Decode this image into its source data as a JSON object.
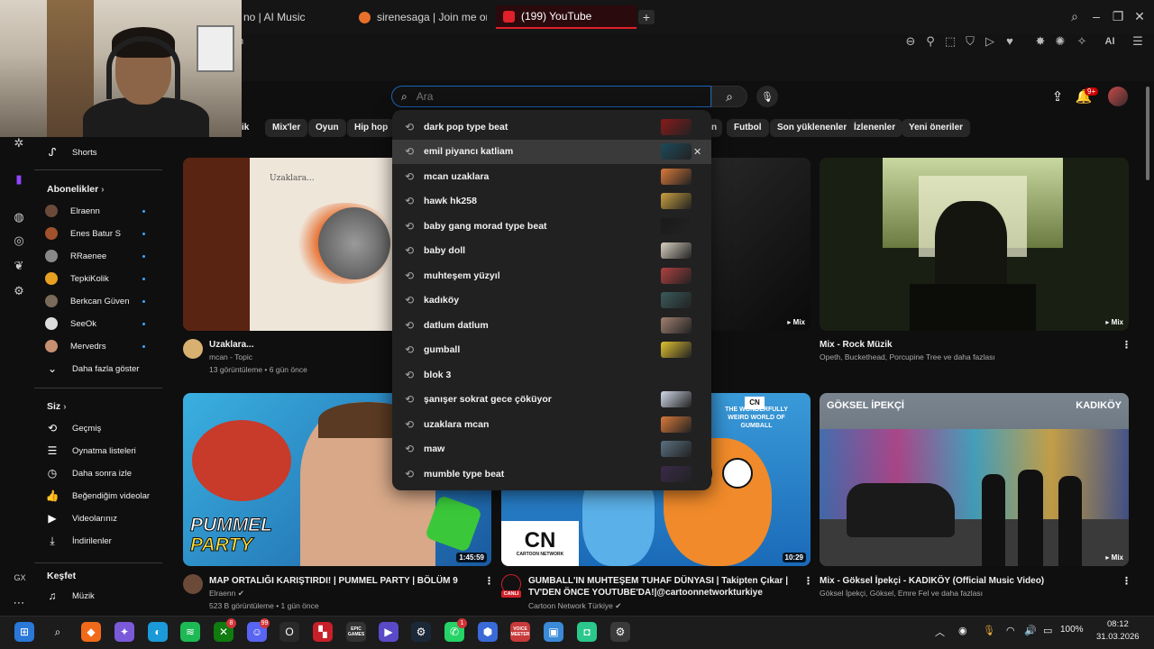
{
  "browser": {
    "tabs": [
      {
        "label": "no | AI Music",
        "active": false
      },
      {
        "label": "sirenesaga | Join me on St",
        "active": false
      },
      {
        "label": "(199) YouTube",
        "active": true
      }
    ],
    "new_tab": "+",
    "address_fragment": "n",
    "ai_label": "AI"
  },
  "header": {
    "search_placeholder": "Ara",
    "notification_count": "9+"
  },
  "chips": [
    "zik",
    "Mix'ler",
    "Oyun",
    "Hip hop",
    "n",
    "Futbol",
    "Son yüklenenler",
    "İzlenenler",
    "Yeni öneriler"
  ],
  "sidebar": {
    "shorts": "Shorts",
    "subscriptions_title": "Abonelikler",
    "subscriptions": [
      {
        "label": "Elraenn",
        "color": "#6b4a3a"
      },
      {
        "label": "Enes Batur S",
        "color": "#a0522d"
      },
      {
        "label": "RRaenee",
        "color": "#888888"
      },
      {
        "label": "TepkiKolik",
        "color": "#e8a020"
      },
      {
        "label": "Berkcan Güven",
        "color": "#7a6a5a"
      },
      {
        "label": "SeeOk",
        "color": "#dddddd"
      },
      {
        "label": "Mervedrs",
        "color": "#c89070"
      }
    ],
    "show_more": "Daha fazla göster",
    "you_title": "Siz",
    "you_items": [
      {
        "label": "Geçmiş",
        "icon": "history-icon"
      },
      {
        "label": "Oynatma listeleri",
        "icon": "playlist-icon"
      },
      {
        "label": "Daha sonra izle",
        "icon": "clock-icon"
      },
      {
        "label": "Beğendiğim videolar",
        "icon": "thumbs-up-icon"
      },
      {
        "label": "Videolarınız",
        "icon": "video-icon"
      },
      {
        "label": "İndirilenler",
        "icon": "download-icon"
      }
    ],
    "explore_title": "Keşfet",
    "music": "Müzik"
  },
  "suggestions": [
    {
      "text": "dark pop type beat",
      "color": "#8a1a1a"
    },
    {
      "text": "emil piyancı katliam",
      "color": "#1d4a5a"
    },
    {
      "text": "mcan uzaklara",
      "color": "#d97a3a"
    },
    {
      "text": "hawk hk258",
      "color": "#c8a040"
    },
    {
      "text": "baby gang morad type beat",
      "color": "#1a1a1a"
    },
    {
      "text": "baby doll",
      "color": "#d8d0c0"
    },
    {
      "text": "muhteşem yüzyıl",
      "color": "#b04040"
    },
    {
      "text": "kadıköy",
      "color": "#3a5a5a"
    },
    {
      "text": "datlum datlum",
      "color": "#a08070"
    },
    {
      "text": "gumball",
      "color": "#e0c030"
    },
    {
      "text": "blok 3",
      "color": ""
    },
    {
      "text": "şanışer sokrat gece çöküyor",
      "color": "#d0d8e8"
    },
    {
      "text": "uzaklara mcan",
      "color": "#d97a3a"
    },
    {
      "text": "maw",
      "color": "#5a7080"
    },
    {
      "text": "mumble type beat",
      "color": "#3a2a4a"
    }
  ],
  "videos": {
    "v1": {
      "title": "Uzaklara...",
      "channel": "mcan - Topic",
      "meta": "13 görüntüleme • 6 gün önce",
      "thumb_text": "Uzaklara..."
    },
    "v2": {
      "mix": "Mix"
    },
    "v3": {
      "title": "Mix - Rock Müzik",
      "meta": "Opeth, Buckethead, Porcupine Tree ve daha fazlası",
      "mix": "Mix"
    },
    "v4": {
      "title": "MAP ORTALIĞI KARIŞTIRDI! | PUMMEL PARTY | BÖLÜM 9",
      "channel": "Elraenn",
      "meta": "523 B görüntüleme • 1 gün önce",
      "duration": "1:45:59",
      "thumb_text_1": "PUMMEL",
      "thumb_text_2": "PARTY"
    },
    "v5": {
      "title": "GUMBALL'IN MUHTEŞEM TUHAF DÜNYASI | Takipten Çıkar | TV'DEN ÖNCE YOUTUBE'DA!|@cartoonnetworkturkiye",
      "channel": "Cartoon Network Türkiye",
      "duration": "10:29",
      "logo": "CN",
      "network": "CARTOON NETWORK",
      "live": "CANLI",
      "promo": "THE WONDERFULLY WEIRD WORLD OF GUMBALL"
    },
    "v6": {
      "title": "Mix - Göksel İpekçi - KADIKÖY (Official Music Video)",
      "meta": "Göksel İpekçi, Göksel, Emre Fel ve daha fazlası",
      "mix": "Mix",
      "thumb_left": "GÖKSEL İPEKÇİ",
      "thumb_right": "KADIKÖY"
    }
  },
  "taskbar": {
    "apps": [
      {
        "name": "windows-start-icon",
        "color": "#2a78d8",
        "badge": ""
      },
      {
        "name": "search-icon",
        "color": "",
        "badge": ""
      },
      {
        "name": "brave-icon",
        "color": "#f06a1a",
        "badge": ""
      },
      {
        "name": "copilot-icon",
        "color": "#7a5ad8",
        "badge": ""
      },
      {
        "name": "edge-icon",
        "color": "#1a9ad8",
        "badge": ""
      },
      {
        "name": "spotify-icon",
        "color": "#1db954",
        "badge": ""
      },
      {
        "name": "xbox-icon",
        "color": "#107c10",
        "badge": "8"
      },
      {
        "name": "discord-icon",
        "color": "#5865f2",
        "badge": "99"
      },
      {
        "name": "opera-gx-icon",
        "color": "#2a2a2a",
        "badge": ""
      },
      {
        "name": "office-icon",
        "color": "#c8202a",
        "badge": ""
      },
      {
        "name": "epic-games-icon",
        "color": "#333333",
        "badge": ""
      },
      {
        "name": "media-player-icon",
        "color": "#5a4ac8",
        "badge": ""
      },
      {
        "name": "steam-icon",
        "color": "#1b2838",
        "badge": ""
      },
      {
        "name": "whatsapp-icon",
        "color": "#25d366",
        "badge": "1"
      },
      {
        "name": "app-icon",
        "color": "#3a6ad8",
        "badge": ""
      },
      {
        "name": "voicemeeter-icon",
        "color": "#c83a3a",
        "badge": ""
      },
      {
        "name": "monitor-icon",
        "color": "#3a8ad8",
        "badge": ""
      },
      {
        "name": "android-icon",
        "color": "#2ac88a",
        "badge": ""
      },
      {
        "name": "settings-app-icon",
        "color": "#3a3a3a",
        "badge": ""
      }
    ],
    "voicemeeter_label": "VOICE MEETER",
    "epic_label": "EPIC GAMES",
    "battery": "100%",
    "time": "08:12",
    "date": "31.03.2026"
  },
  "opera": {
    "gx_label": "GX"
  }
}
